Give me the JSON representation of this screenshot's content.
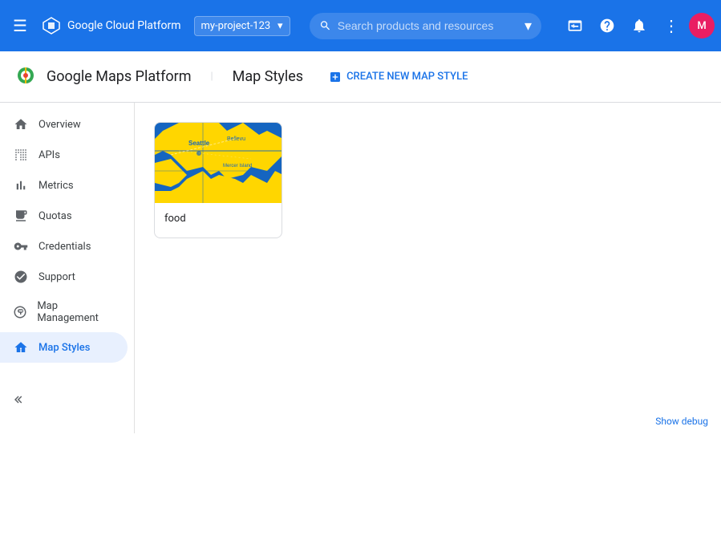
{
  "topbar": {
    "menu_icon": "☰",
    "logo_text": "Google Cloud Platform",
    "project_name": "my-project-123",
    "search_placeholder": "Search products and resources",
    "icons": {
      "cloud": "⬛",
      "notifications": "🔔",
      "help": "?",
      "more": "⋮"
    }
  },
  "subheader": {
    "app_title": "Google Maps Platform",
    "page_title": "Map Styles",
    "create_button": "CREATE NEW MAP STYLE"
  },
  "sidebar": {
    "items": [
      {
        "id": "overview",
        "label": "Overview",
        "icon": "home"
      },
      {
        "id": "apis",
        "label": "APIs",
        "icon": "list"
      },
      {
        "id": "metrics",
        "label": "Metrics",
        "icon": "bar_chart"
      },
      {
        "id": "quotas",
        "label": "Quotas",
        "icon": "monitor"
      },
      {
        "id": "credentials",
        "label": "Credentials",
        "icon": "key"
      },
      {
        "id": "support",
        "label": "Support",
        "icon": "person"
      },
      {
        "id": "map_management",
        "label": "Map Management",
        "icon": "layers"
      },
      {
        "id": "map_styles",
        "label": "Map Styles",
        "icon": "palette",
        "active": true
      }
    ]
  },
  "main": {
    "map_cards": [
      {
        "id": "food",
        "label": "food"
      }
    ]
  },
  "footer": {
    "collapse_icon": "◀▶",
    "debug_link": "Show debug"
  }
}
